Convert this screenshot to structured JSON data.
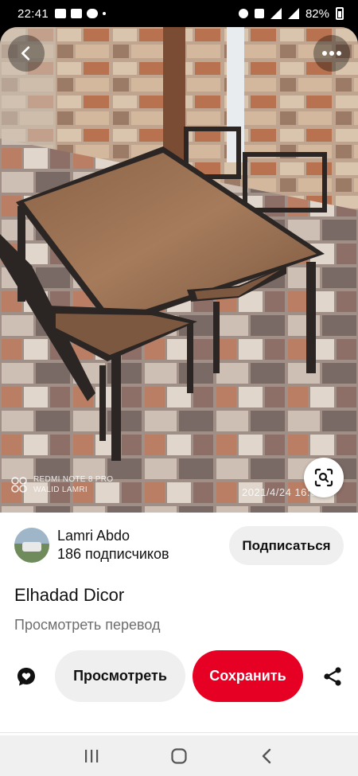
{
  "status_bar": {
    "time": "22:41",
    "battery": "82%"
  },
  "photo": {
    "description": "",
    "watermark_line1": "REDMI NOTE 8 PRO",
    "watermark_line2": "WALID LAMRI",
    "timestamp": "2021/4/24 16:37"
  },
  "pin": {
    "author_name": "Lamri Abdo",
    "subscribers": "186 подписчиков",
    "follow_label": "Подписаться",
    "title": "Elhadad Dicor",
    "translate_label": "Просмотреть перевод",
    "view_label": "Просмотреть",
    "save_label": "Сохранить"
  },
  "icons": {
    "back": "chevron-left-icon",
    "more": "more-horizontal-icon",
    "lens": "visual-search-icon",
    "comment": "comment-heart-icon",
    "share": "share-icon",
    "nav_recents": "recents-icon",
    "nav_home": "home-icon",
    "nav_back": "back-icon"
  },
  "colors": {
    "save": "#e60023",
    "button_gray": "#efefef",
    "nav_bar": "#f0f0f0"
  }
}
